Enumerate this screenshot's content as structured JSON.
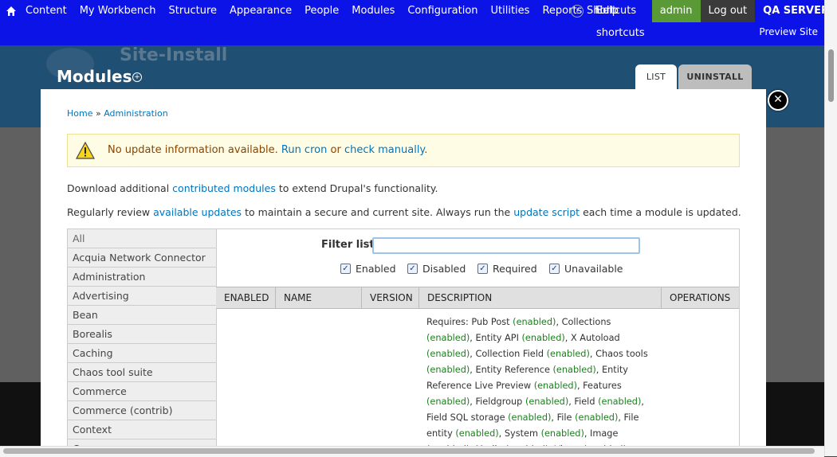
{
  "toolbar": {
    "items": [
      "Content",
      "My Workbench",
      "Structure",
      "Appearance",
      "People",
      "Modules",
      "Configuration",
      "Utilities",
      "Reports",
      "Help"
    ],
    "shortcuts_label": "Shortcuts",
    "edit_shortcuts_label": "Edit shortcuts",
    "admin_label": "admin",
    "logout_label": "Log out",
    "server_label": "QA SERVER",
    "preview_label": "Preview Site"
  },
  "header": {
    "site_name": "Site-Install",
    "page_title": "Modules",
    "tabs": [
      "LIST",
      "UNINSTALL"
    ]
  },
  "breadcrumb": {
    "home": "Home",
    "separator": "»",
    "admin": "Administration"
  },
  "message": {
    "text": "No update information available.",
    "run_cron": "Run cron",
    "or": "or",
    "check_manually": "check manually",
    "period": "."
  },
  "para1": {
    "before": "Download additional",
    "link": "contributed modules",
    "after": "to extend Drupal's functionality."
  },
  "para2": {
    "before": "Regularly review",
    "link1": "available updates",
    "middle": "to maintain a secure and current site. Always run the",
    "link2": "update script",
    "after": "each time a module is updated."
  },
  "vtabs": [
    "All",
    "Acquia Network Connector",
    "Administration",
    "Advertising",
    "Bean",
    "Borealis",
    "Caching",
    "Chaos tool suite",
    "Commerce",
    "Commerce (contrib)",
    "Context",
    "C..."
  ],
  "filter": {
    "label": "Filter list",
    "value": "",
    "checkboxes": [
      "Enabled",
      "Disabled",
      "Required",
      "Unavailable"
    ]
  },
  "table": {
    "headers": [
      "ENABLED",
      "NAME",
      "VERSION",
      "DESCRIPTION",
      "OPERATIONS"
    ]
  },
  "description_requires": [
    {
      "t": "Requires: Pub Post "
    },
    {
      "e": "(enabled)"
    },
    {
      "t": ", Collections "
    },
    {
      "e": "(enabled)"
    },
    {
      "t": ", Entity API "
    },
    {
      "e": "(enabled)"
    },
    {
      "t": ", X Autoload "
    },
    {
      "e": "(enabled)"
    },
    {
      "t": ", Collection Field "
    },
    {
      "e": "(enabled)"
    },
    {
      "t": ", Chaos tools "
    },
    {
      "e": "(enabled)"
    },
    {
      "t": ", Entity Reference "
    },
    {
      "e": "(enabled)"
    },
    {
      "t": ", Entity Reference Live Preview "
    },
    {
      "e": "(enabled)"
    },
    {
      "t": ", Features "
    },
    {
      "e": "(enabled)"
    },
    {
      "t": ", Fieldgroup "
    },
    {
      "e": "(enabled)"
    },
    {
      "t": ", Field "
    },
    {
      "e": "(enabled)"
    },
    {
      "t": ", Field SQL storage "
    },
    {
      "e": "(enabled)"
    },
    {
      "t": ", File "
    },
    {
      "e": "(enabled)"
    },
    {
      "t": ", File entity "
    },
    {
      "e": "(enabled)"
    },
    {
      "t": ", System "
    },
    {
      "e": "(enabled)"
    },
    {
      "t": ", Image "
    },
    {
      "e": "(enabled)"
    },
    {
      "t": ", Media "
    },
    {
      "e": "(enabled)"
    },
    {
      "t": ", Views "
    },
    {
      "e": "(enabled)"
    },
    {
      "t": ","
    }
  ],
  "colors": {
    "toolbar": "#0b13e6",
    "header": "#1f4f73",
    "admin": "#5a9a36",
    "link": "#0074bd",
    "enabled": "#1e7f20"
  }
}
